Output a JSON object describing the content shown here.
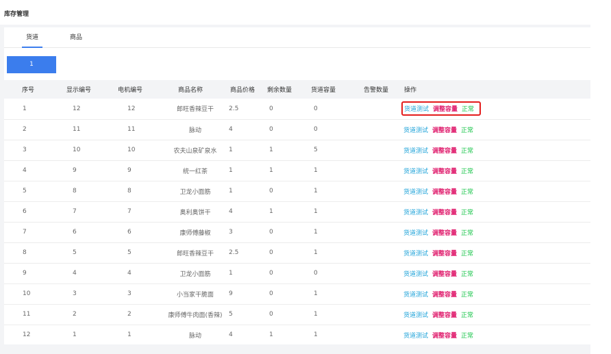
{
  "page": {
    "title": "库存管理"
  },
  "tabs": [
    {
      "label": "货道",
      "active": true
    },
    {
      "label": "商品",
      "active": false
    }
  ],
  "pager": {
    "current": "1"
  },
  "table": {
    "headers": {
      "index": "序号",
      "display_no": "显示编号",
      "motor_no": "电机编号",
      "product_name": "商品名称",
      "price": "商品价格",
      "remaining": "剩余数量",
      "capacity": "货道容量",
      "alarm": "告警数量",
      "operations": "操作"
    },
    "op_labels": {
      "test": "货道测试",
      "adjust": "调整容量",
      "status": "正常"
    },
    "rows": [
      {
        "index": "1",
        "display_no": "12",
        "motor_no": "12",
        "product_name": "郎旺香辣豆干",
        "price": "2.5",
        "remaining": "0",
        "capacity": "0",
        "alarm": ""
      },
      {
        "index": "2",
        "display_no": "11",
        "motor_no": "11",
        "product_name": "脉动",
        "price": "4",
        "remaining": "0",
        "capacity": "0",
        "alarm": ""
      },
      {
        "index": "3",
        "display_no": "10",
        "motor_no": "10",
        "product_name": "农夫山泉矿泉水",
        "price": "1",
        "remaining": "1",
        "capacity": "5",
        "alarm": ""
      },
      {
        "index": "4",
        "display_no": "9",
        "motor_no": "9",
        "product_name": "统一红茶",
        "price": "1",
        "remaining": "1",
        "capacity": "1",
        "alarm": ""
      },
      {
        "index": "5",
        "display_no": "8",
        "motor_no": "8",
        "product_name": "卫龙小面筋",
        "price": "1",
        "remaining": "0",
        "capacity": "1",
        "alarm": ""
      },
      {
        "index": "6",
        "display_no": "7",
        "motor_no": "7",
        "product_name": "奥利奥饼干",
        "price": "4",
        "remaining": "1",
        "capacity": "1",
        "alarm": ""
      },
      {
        "index": "7",
        "display_no": "6",
        "motor_no": "6",
        "product_name": "康师傅藤椒",
        "price": "3",
        "remaining": "0",
        "capacity": "1",
        "alarm": ""
      },
      {
        "index": "8",
        "display_no": "5",
        "motor_no": "5",
        "product_name": "郎旺香辣豆干",
        "price": "2.5",
        "remaining": "0",
        "capacity": "1",
        "alarm": ""
      },
      {
        "index": "9",
        "display_no": "4",
        "motor_no": "4",
        "product_name": "卫龙小面筋",
        "price": "1",
        "remaining": "0",
        "capacity": "0",
        "alarm": ""
      },
      {
        "index": "10",
        "display_no": "3",
        "motor_no": "3",
        "product_name": "小当家干脆面",
        "price": "9",
        "remaining": "0",
        "capacity": "1",
        "alarm": ""
      },
      {
        "index": "11",
        "display_no": "2",
        "motor_no": "2",
        "product_name": "康师傅牛肉面(香辣)",
        "price": "5",
        "remaining": "0",
        "capacity": "1",
        "alarm": ""
      },
      {
        "index": "12",
        "display_no": "1",
        "motor_no": "1",
        "product_name": "脉动",
        "price": "4",
        "remaining": "1",
        "capacity": "1",
        "alarm": ""
      }
    ]
  },
  "colors": {
    "accent": "#3b7ded",
    "op_test": "#1fa3d9",
    "op_adjust": "#e0206f",
    "op_status": "#19c44a",
    "highlight_border": "#e31b1b"
  }
}
